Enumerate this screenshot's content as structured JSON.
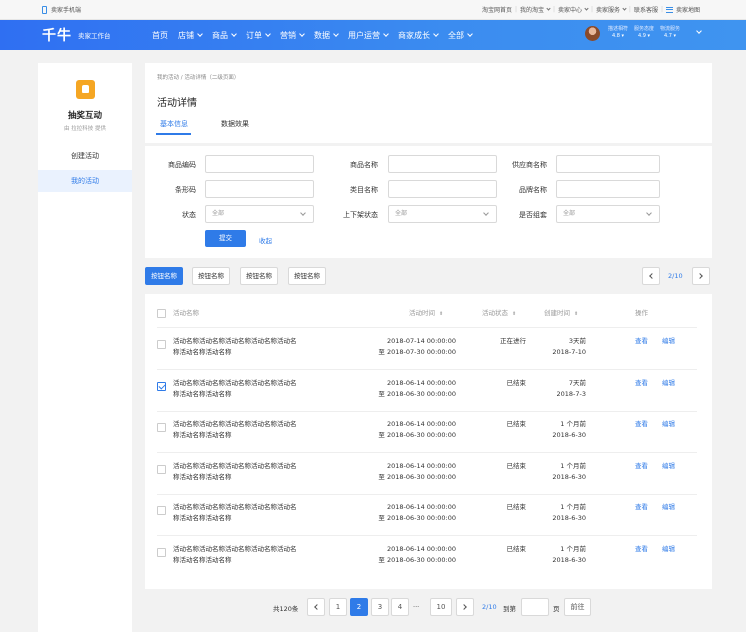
{
  "topbar": {
    "left_label": "卖家手机端",
    "right_links": [
      "淘宝网首页",
      "我的淘宝",
      "卖家中心",
      "卖家服务",
      "联系客服",
      "卖家地图"
    ]
  },
  "nav": {
    "logo": "千牛",
    "logo_sub": "卖家工作台",
    "items": [
      "首页",
      "店铺",
      "商品",
      "订单",
      "营销",
      "数据",
      "用户运营",
      "商家成长",
      "全部"
    ],
    "scores": [
      {
        "label": "描述相符",
        "value": "4.8"
      },
      {
        "label": "服务态度",
        "value": "4.9"
      },
      {
        "label": "物流服务",
        "value": "4.7"
      }
    ]
  },
  "sidebar": {
    "app_title": "抽奖互动",
    "app_sub": "由 拉拉科技 提供",
    "items": [
      {
        "label": "创建活动",
        "active": false
      },
      {
        "label": "我的活动",
        "active": true
      }
    ]
  },
  "header": {
    "breadcrumb": "我的活动 / 活动详情（二级页面）",
    "title": "活动详情",
    "tabs": [
      {
        "label": "基本信息",
        "active": true
      },
      {
        "label": "数据效果",
        "active": false
      }
    ]
  },
  "filters": {
    "code": {
      "label": "商品编码",
      "value": ""
    },
    "name": {
      "label": "商品名称",
      "value": ""
    },
    "supplier": {
      "label": "供应商名称",
      "value": ""
    },
    "barcode": {
      "label": "条形码",
      "value": ""
    },
    "category": {
      "label": "类目名称",
      "value": ""
    },
    "brand": {
      "label": "品牌名称",
      "value": ""
    },
    "status": {
      "label": "状态",
      "value": "全部"
    },
    "shelf": {
      "label": "上下架状态",
      "value": "全部"
    },
    "combo": {
      "label": "是否组套",
      "value": "全部"
    },
    "submit": "提交",
    "reset": "收起"
  },
  "actions": {
    "buttons": [
      "按钮名称",
      "按钮名称",
      "按钮名称",
      "按钮名称"
    ],
    "page_indicator": "2/10"
  },
  "table": {
    "headers": {
      "name": "活动名称",
      "time": "活动时间",
      "status": "活动状态",
      "created": "创建时间",
      "ops": "操作"
    },
    "rows": [
      {
        "name1": "活动名称活动名称活动名称活动名称活动名",
        "name2": "称活动名称活动名称",
        "t1": "2018-07-14 00:00:00",
        "t2": "至 2018-07-30 00:00:00",
        "status": "正在进行",
        "rel": "3天前",
        "date": "2018-7-10",
        "checked": false
      },
      {
        "name1": "活动名称活动名称活动名称活动名称活动名",
        "name2": "称活动名称活动名称",
        "t1": "2018-06-14 00:00:00",
        "t2": "至 2018-06-30 00:00:00",
        "status": "已结束",
        "rel": "7天前",
        "date": "2018-7-3",
        "checked": true
      },
      {
        "name1": "活动名称活动名称活动名称活动名称活动名",
        "name2": "称活动名称活动名称",
        "t1": "2018-06-14 00:00:00",
        "t2": "至 2018-06-30 00:00:00",
        "status": "已结束",
        "rel": "1 个月前",
        "date": "2018-6-30",
        "checked": false
      },
      {
        "name1": "活动名称活动名称活动名称活动名称活动名",
        "name2": "称活动名称活动名称",
        "t1": "2018-06-14 00:00:00",
        "t2": "至 2018-06-30 00:00:00",
        "status": "已结束",
        "rel": "1 个月前",
        "date": "2018-6-30",
        "checked": false
      },
      {
        "name1": "活动名称活动名称活动名称活动名称活动名",
        "name2": "称活动名称活动名称",
        "t1": "2018-06-14 00:00:00",
        "t2": "至 2018-06-30 00:00:00",
        "status": "已结束",
        "rel": "1 个月前",
        "date": "2018-6-30",
        "checked": false
      },
      {
        "name1": "活动名称活动名称活动名称活动名称活动名",
        "name2": "称活动名称活动名称",
        "t1": "2018-06-14 00:00:00",
        "t2": "至 2018-06-30 00:00:00",
        "status": "已结束",
        "rel": "1 个月前",
        "date": "2018-6-30",
        "checked": false
      }
    ],
    "op_view": "查看",
    "op_edit": "编辑"
  },
  "pager": {
    "total": "共120条",
    "pages": [
      "1",
      "2",
      "3",
      "4",
      "···",
      "10"
    ],
    "current": "2",
    "indicator": "2/10",
    "goto_label": "到第",
    "page_unit": "页",
    "goto_button": "前往"
  },
  "colors": {
    "primary": "#2f7be8",
    "accent": "#f5a623"
  }
}
